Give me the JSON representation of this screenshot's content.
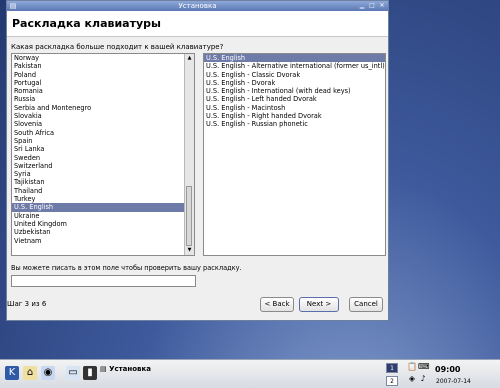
{
  "window": {
    "title": "Установка"
  },
  "header": {
    "title": "Раскладка клавиатуры"
  },
  "question": "Какая раскладка больше подходит к вашей клавиатуре?",
  "countries": [
    {
      "label": "Norway"
    },
    {
      "label": "Pakistan"
    },
    {
      "label": "Poland"
    },
    {
      "label": "Portugal"
    },
    {
      "label": "Romania"
    },
    {
      "label": "Russia"
    },
    {
      "label": "Serbia and Montenegro"
    },
    {
      "label": "Slovakia"
    },
    {
      "label": "Slovenia"
    },
    {
      "label": "South Africa"
    },
    {
      "label": "Spain"
    },
    {
      "label": "Sri Lanka"
    },
    {
      "label": "Sweden"
    },
    {
      "label": "Switzerland"
    },
    {
      "label": "Syria"
    },
    {
      "label": "Tajikistan"
    },
    {
      "label": "Thailand"
    },
    {
      "label": "Turkey"
    },
    {
      "label": "U.S. English",
      "selected": true
    },
    {
      "label": "Ukraine"
    },
    {
      "label": "United Kingdom"
    },
    {
      "label": "Uzbekistan"
    },
    {
      "label": "Vietnam"
    }
  ],
  "variants": [
    {
      "label": "U.S. English",
      "selected": true
    },
    {
      "label": "U.S. English - Alternative international (former us_intl)"
    },
    {
      "label": "U.S. English - Classic Dvorak"
    },
    {
      "label": "U.S. English - Dvorak"
    },
    {
      "label": "U.S. English - International (with dead keys)"
    },
    {
      "label": "U.S. English - Left handed Dvorak"
    },
    {
      "label": "U.S. English - Macintosh"
    },
    {
      "label": "U.S. English - Right handed Dvorak"
    },
    {
      "label": "U.S. English - Russian phonetic"
    }
  ],
  "test_hint": "Вы можете писать в этом поле чтобы проверить вашу раскладку.",
  "test_value": "",
  "step": "Шаг 3 из 6",
  "buttons": {
    "back": "< Back",
    "next": "Next >",
    "cancel": "Cancel"
  },
  "taskbar": {
    "task_label": "Установка",
    "clock": "09:00",
    "date": "2007-07-14",
    "pager": [
      "1",
      "2"
    ]
  }
}
